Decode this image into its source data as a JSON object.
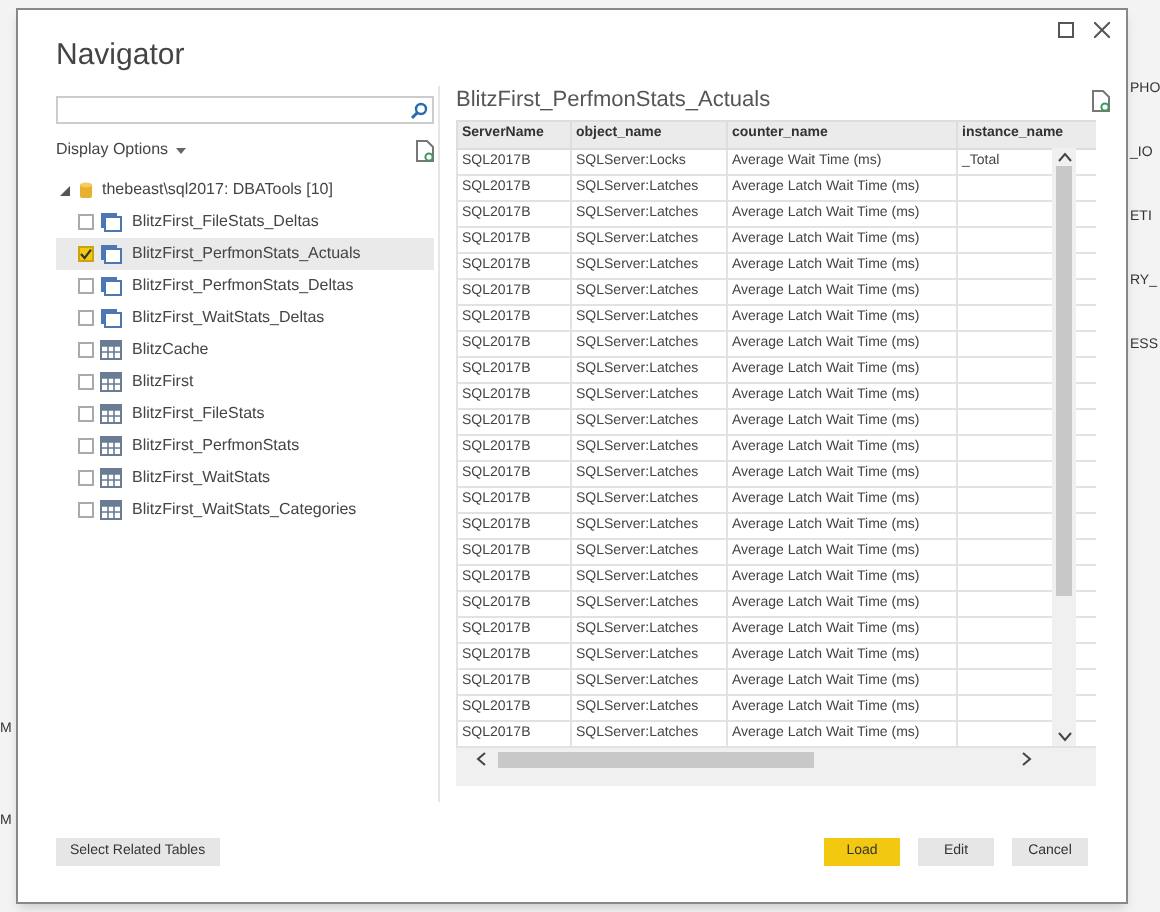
{
  "background": {
    "right_fragments": [
      "PHO",
      "_IO",
      "ETI",
      "RY_",
      "ESS"
    ],
    "left_fragments": [
      "M",
      "M"
    ]
  },
  "window": {
    "title": "Navigator"
  },
  "display_options": {
    "label": "Display Options"
  },
  "tree": {
    "label": "thebeast\\sql2017: DBATools [10]",
    "expanded": true,
    "children": [
      {
        "label": "BlitzFirst_FileStats_Deltas",
        "kind": "view",
        "checked": false,
        "selected": false
      },
      {
        "label": "BlitzFirst_PerfmonStats_Actuals",
        "kind": "view",
        "checked": true,
        "selected": true
      },
      {
        "label": "BlitzFirst_PerfmonStats_Deltas",
        "kind": "view",
        "checked": false,
        "selected": false
      },
      {
        "label": "BlitzFirst_WaitStats_Deltas",
        "kind": "view",
        "checked": false,
        "selected": false
      },
      {
        "label": "BlitzCache",
        "kind": "table",
        "checked": false,
        "selected": false
      },
      {
        "label": "BlitzFirst",
        "kind": "table",
        "checked": false,
        "selected": false
      },
      {
        "label": "BlitzFirst_FileStats",
        "kind": "table",
        "checked": false,
        "selected": false
      },
      {
        "label": "BlitzFirst_PerfmonStats",
        "kind": "table",
        "checked": false,
        "selected": false
      },
      {
        "label": "BlitzFirst_WaitStats",
        "kind": "table",
        "checked": false,
        "selected": false
      },
      {
        "label": "BlitzFirst_WaitStats_Categories",
        "kind": "table",
        "checked": false,
        "selected": false
      }
    ]
  },
  "preview": {
    "title": "BlitzFirst_PerfmonStats_Actuals",
    "columns": [
      "ServerName",
      "object_name",
      "counter_name",
      "instance_name"
    ],
    "rows": [
      [
        "SQL2017B",
        "SQLServer:Locks",
        "Average Wait Time (ms)",
        "_Total"
      ],
      [
        "SQL2017B",
        "SQLServer:Latches",
        "Average Latch Wait Time (ms)",
        ""
      ],
      [
        "SQL2017B",
        "SQLServer:Latches",
        "Average Latch Wait Time (ms)",
        ""
      ],
      [
        "SQL2017B",
        "SQLServer:Latches",
        "Average Latch Wait Time (ms)",
        ""
      ],
      [
        "SQL2017B",
        "SQLServer:Latches",
        "Average Latch Wait Time (ms)",
        ""
      ],
      [
        "SQL2017B",
        "SQLServer:Latches",
        "Average Latch Wait Time (ms)",
        ""
      ],
      [
        "SQL2017B",
        "SQLServer:Latches",
        "Average Latch Wait Time (ms)",
        ""
      ],
      [
        "SQL2017B",
        "SQLServer:Latches",
        "Average Latch Wait Time (ms)",
        ""
      ],
      [
        "SQL2017B",
        "SQLServer:Latches",
        "Average Latch Wait Time (ms)",
        ""
      ],
      [
        "SQL2017B",
        "SQLServer:Latches",
        "Average Latch Wait Time (ms)",
        ""
      ],
      [
        "SQL2017B",
        "SQLServer:Latches",
        "Average Latch Wait Time (ms)",
        ""
      ],
      [
        "SQL2017B",
        "SQLServer:Latches",
        "Average Latch Wait Time (ms)",
        ""
      ],
      [
        "SQL2017B",
        "SQLServer:Latches",
        "Average Latch Wait Time (ms)",
        ""
      ],
      [
        "SQL2017B",
        "SQLServer:Latches",
        "Average Latch Wait Time (ms)",
        ""
      ],
      [
        "SQL2017B",
        "SQLServer:Latches",
        "Average Latch Wait Time (ms)",
        ""
      ],
      [
        "SQL2017B",
        "SQLServer:Latches",
        "Average Latch Wait Time (ms)",
        ""
      ],
      [
        "SQL2017B",
        "SQLServer:Latches",
        "Average Latch Wait Time (ms)",
        ""
      ],
      [
        "SQL2017B",
        "SQLServer:Latches",
        "Average Latch Wait Time (ms)",
        ""
      ],
      [
        "SQL2017B",
        "SQLServer:Latches",
        "Average Latch Wait Time (ms)",
        ""
      ],
      [
        "SQL2017B",
        "SQLServer:Latches",
        "Average Latch Wait Time (ms)",
        ""
      ],
      [
        "SQL2017B",
        "SQLServer:Latches",
        "Average Latch Wait Time (ms)",
        ""
      ],
      [
        "SQL2017B",
        "SQLServer:Latches",
        "Average Latch Wait Time (ms)",
        ""
      ],
      [
        "SQL2017B",
        "SQLServer:Latches",
        "Average Latch Wait Time (ms)",
        ""
      ]
    ]
  },
  "buttons": [
    {
      "label": "Select Related Tables",
      "kind": "secondary"
    },
    {
      "label": "Load",
      "kind": "primary"
    },
    {
      "label": "Edit",
      "kind": "secondary"
    },
    {
      "label": "Cancel",
      "kind": "secondary"
    }
  ]
}
